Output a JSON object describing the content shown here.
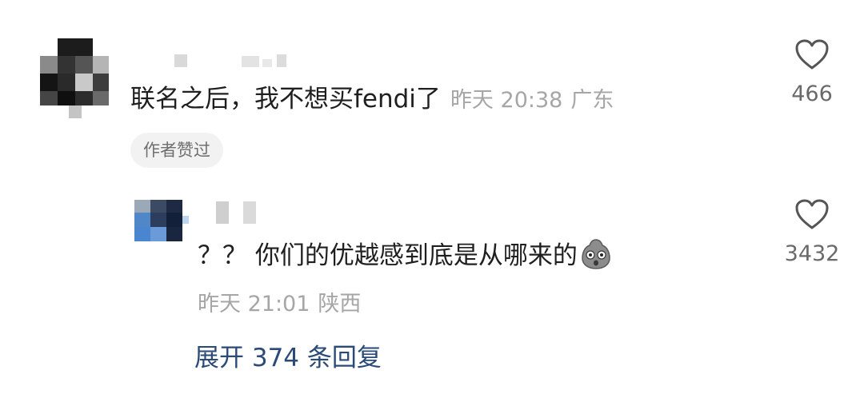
{
  "main_comment": {
    "text": "联名之后，我不想买fendi了",
    "time": "昨天 20:38",
    "location": "广东",
    "author_liked_badge": "作者赞过",
    "like_count": "466",
    "like_icon": "heart-outline-icon"
  },
  "reply": {
    "text": "？？ 你们的优越感到底是从哪来的",
    "emoji": "shocked-face-emoji",
    "time": "昨天 21:01",
    "location": "陕西",
    "like_count": "3432",
    "like_icon": "heart-outline-icon"
  },
  "expand_replies": {
    "label": "展开 374 条回复"
  },
  "colors": {
    "text_primary": "#1f1f1f",
    "text_meta": "#a6a6a6",
    "link": "#2a4a78",
    "badge_bg": "#f2f2f2"
  }
}
